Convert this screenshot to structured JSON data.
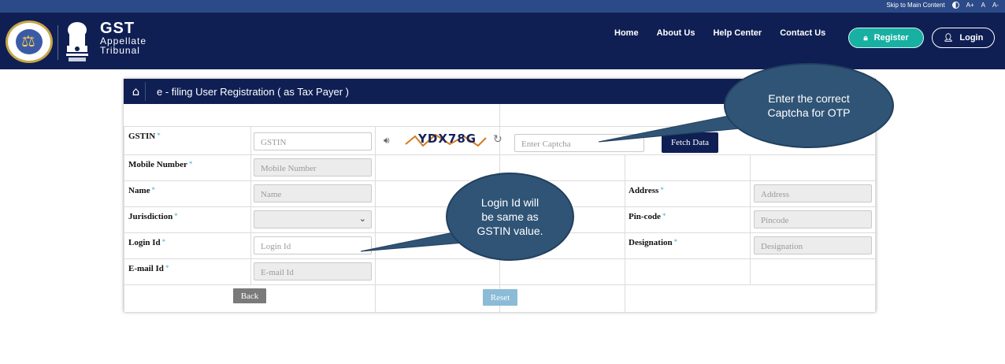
{
  "topbar": {
    "skip_link": "Skip to Main Content",
    "font_large": "A+",
    "font_normal": "A",
    "font_small": "A-"
  },
  "header": {
    "title": "GST",
    "subtitle_line1": "Appellate",
    "subtitle_line2": "Tribunal",
    "nav": [
      "Home",
      "About Us",
      "Help Center",
      "Contact Us"
    ],
    "register_label": "Register",
    "login_label": "Login"
  },
  "form": {
    "title": "e - filing User Registration ( as Tax Payer )",
    "gstin_label": "GSTIN",
    "gstin_placeholder": "GSTIN",
    "captcha_text": "YDX78G",
    "captcha_placeholder": "Enter Captcha",
    "fetch_label": "Fetch Data",
    "mobile_label": "Mobile Number",
    "mobile_placeholder": "Mobile Number",
    "name_label": "Name",
    "name_placeholder": "Name",
    "jurisdiction_label": "Jurisdiction",
    "jurisdiction_value": "",
    "login_id_label": "Login Id",
    "login_id_placeholder": "Login Id",
    "email_label": "E-mail Id",
    "email_placeholder": "E-mail Id",
    "address_label": "Address",
    "address_placeholder": "Address",
    "pincode_label": "Pin-code",
    "pincode_placeholder": "Pincode",
    "designation_label": "Designation",
    "designation_placeholder": "Designation",
    "back_label": "Back",
    "reset_label": "Reset",
    "required_mark": "*"
  },
  "callouts": {
    "captcha_line1": "Enter the correct",
    "captcha_line2": "Captcha for OTP",
    "login_line1": "Login Id will",
    "login_line2": "be same as",
    "login_line3": "GSTIN value."
  },
  "colors": {
    "header_bg": "#0f1f54",
    "topbar_bg": "#2c4a87",
    "register_bg": "#17b0a2",
    "callout_bg": "#2f5476",
    "required": "#3cb2d6"
  }
}
